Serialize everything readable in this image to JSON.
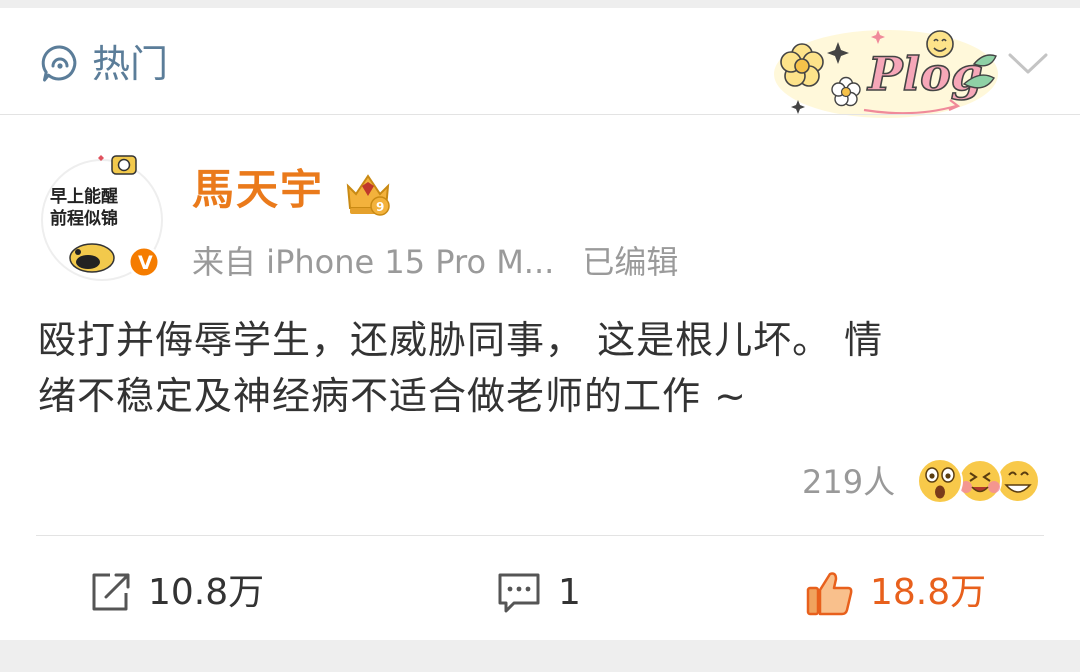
{
  "header": {
    "section_label": "热门",
    "sticker_text": "Plog"
  },
  "post": {
    "author": {
      "name": "馬天宇",
      "avatar_text": [
        "早上能醒",
        "前程似锦"
      ],
      "verified_badge": "V",
      "member_level": "9"
    },
    "meta": {
      "source": "来自 iPhone 15 Pro M...",
      "edited": "已编辑"
    },
    "text_lines": [
      "殴打并侮辱学生，还威胁同事， 这是根儿坏。 情",
      "绪不稳定及神经病不适合做老师的工作 ~"
    ],
    "reactions": {
      "count": "219人",
      "emojis": [
        "surprised-emoji-icon",
        "laughing-tears-emoji-icon",
        "grin-emoji-icon"
      ]
    }
  },
  "actions": {
    "share_count": "10.8万",
    "comment_count": "1",
    "like_count": "18.8万"
  },
  "colors": {
    "username": "#ea7a1b",
    "section": "#5b7d99",
    "like": "#e8601c",
    "meta": "#9a9a9a",
    "body": "#333333"
  }
}
